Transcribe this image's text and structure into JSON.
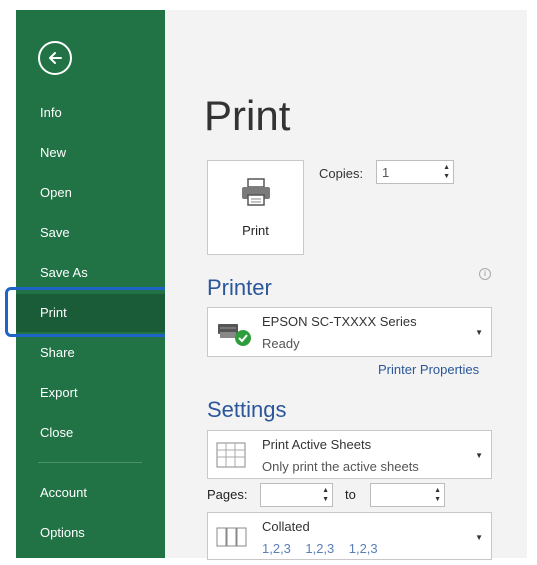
{
  "sidebar": {
    "items": [
      {
        "label": "Info"
      },
      {
        "label": "New"
      },
      {
        "label": "Open"
      },
      {
        "label": "Save"
      },
      {
        "label": "Save As"
      },
      {
        "label": "Print",
        "selected": true
      },
      {
        "label": "Share"
      },
      {
        "label": "Export"
      },
      {
        "label": "Close"
      },
      {
        "label": "Account"
      },
      {
        "label": "Options"
      }
    ]
  },
  "main": {
    "title": "Print",
    "print_button_label": "Print",
    "copies_label": "Copies:",
    "copies_value": "1",
    "printer_section": "Printer",
    "printer_name": "EPSON SC-TXXXX Series",
    "printer_status": "Ready",
    "printer_properties": "Printer Properties",
    "settings_section": "Settings",
    "scope_primary": "Print Active Sheets",
    "scope_secondary": "Only print the active sheets",
    "pages_label": "Pages:",
    "to_label": "to",
    "collation_primary": "Collated",
    "collation_secondary": "1,2,3    1,2,3    1,2,3"
  },
  "colors": {
    "sidebar": "#217346",
    "accent": "#2b579a",
    "highlight": "#1e63c8"
  }
}
